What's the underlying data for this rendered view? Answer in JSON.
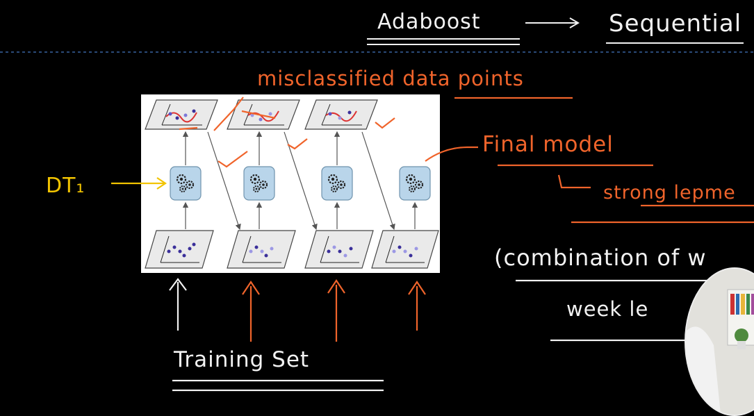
{
  "title": {
    "left": "Adaboost",
    "right": "Sequential"
  },
  "annotations": {
    "misclassified": "misclassified data points",
    "final_model": "Final model",
    "strong_learner": "strong lepme",
    "combination": "(combination of w",
    "weak_learner": "week le",
    "training_set": "Training Set",
    "dt1": "DT₁"
  },
  "colors": {
    "background": "#000000",
    "ink_white": "#f2f2f2",
    "ink_orange": "#f0642b",
    "ink_yellow": "#f2c400",
    "model_box": "#b9d5ea",
    "plot_bg": "#eaeaea"
  },
  "diagram": {
    "columns": 4,
    "icons": [
      "gear-icon"
    ]
  }
}
